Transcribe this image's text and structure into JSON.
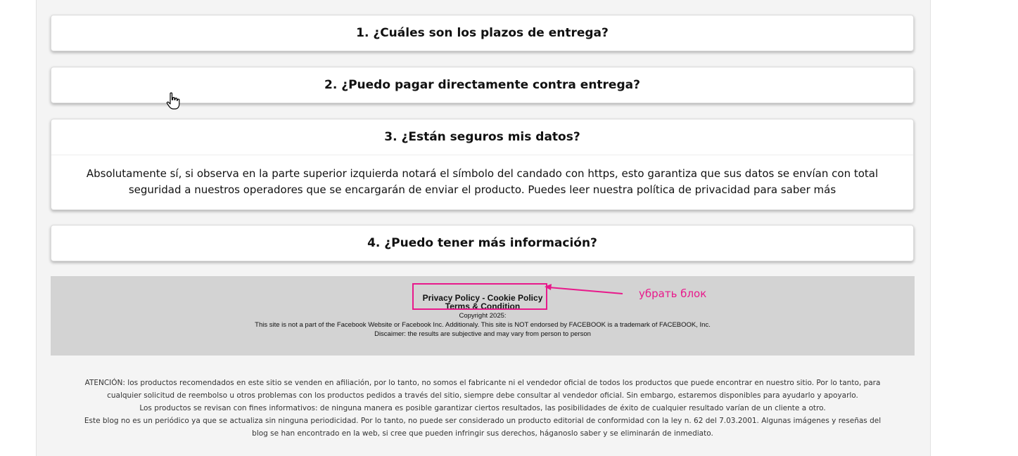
{
  "faq": {
    "items": [
      {
        "question": "1. ¿Cuáles son los plazos de entrega?"
      },
      {
        "question": "2. ¿Puedo pagar directamente contra entrega?"
      },
      {
        "question": "3. ¿Están seguros mis datos?",
        "answer": "Absolutamente sí, si observa en la parte superior izquierda notará el símbolo del candado con https, esto garantiza que sus datos se envían con total seguridad a nuestros operadores que se encargarán de enviar el producto. Puedes leer nuestra política de privacidad para saber más"
      },
      {
        "question": "4. ¿Puedo tener más información?"
      }
    ]
  },
  "footer": {
    "privacy_policy": "Privacy Policy",
    "separator": " - ",
    "cookie_policy": "Cookie Policy",
    "terms": "Terms & Condition",
    "copyright": "Copyright 2025:",
    "facebook_notice": "This site is not a part of the Facebook Website or Facebook Inc. Additionaly. This site is NOT endorsed by FACEBOOK is a trademark of FACEBOOK, Inc.",
    "results_notice": "Discaimer: the results are subjective and may vary from person to person"
  },
  "annotation": {
    "text": "убрать блок",
    "color": "#e8198b"
  },
  "disclaimer": {
    "paragraphs": [
      "ATENCIÓN: los productos recomendados en este sitio se venden en afiliación, por lo tanto, no somos el fabricante ni el vendedor oficial de todos los productos que puede encontrar en nuestro sitio. Por lo tanto, para cualquier solicitud de reembolso u otros problemas con los productos pedidos a través del sitio, siempre debe consultar al vendedor oficial. Sin embargo, estaremos disponibles para ayudarlo y apoyarlo.",
      "Los productos se revisan con fines informativos: de ninguna manera es posible garantizar ciertos resultados, las posibilidades de éxito de cualquier resultado varían de un cliente a otro.",
      "Este blog no es un periódico ya que se actualiza sin ninguna periodicidad. Por lo tanto, no puede ser considerado un producto editorial de conformidad con la ley n. 62 del 7.03.2001. Algunas imágenes y reseñas del blog se han encontrado en la web, si cree que pueden infringir sus derechos, háganoslo saber y se eliminarán de inmediato."
    ]
  },
  "cursor": {
    "icon": "hand-pointer-icon"
  }
}
